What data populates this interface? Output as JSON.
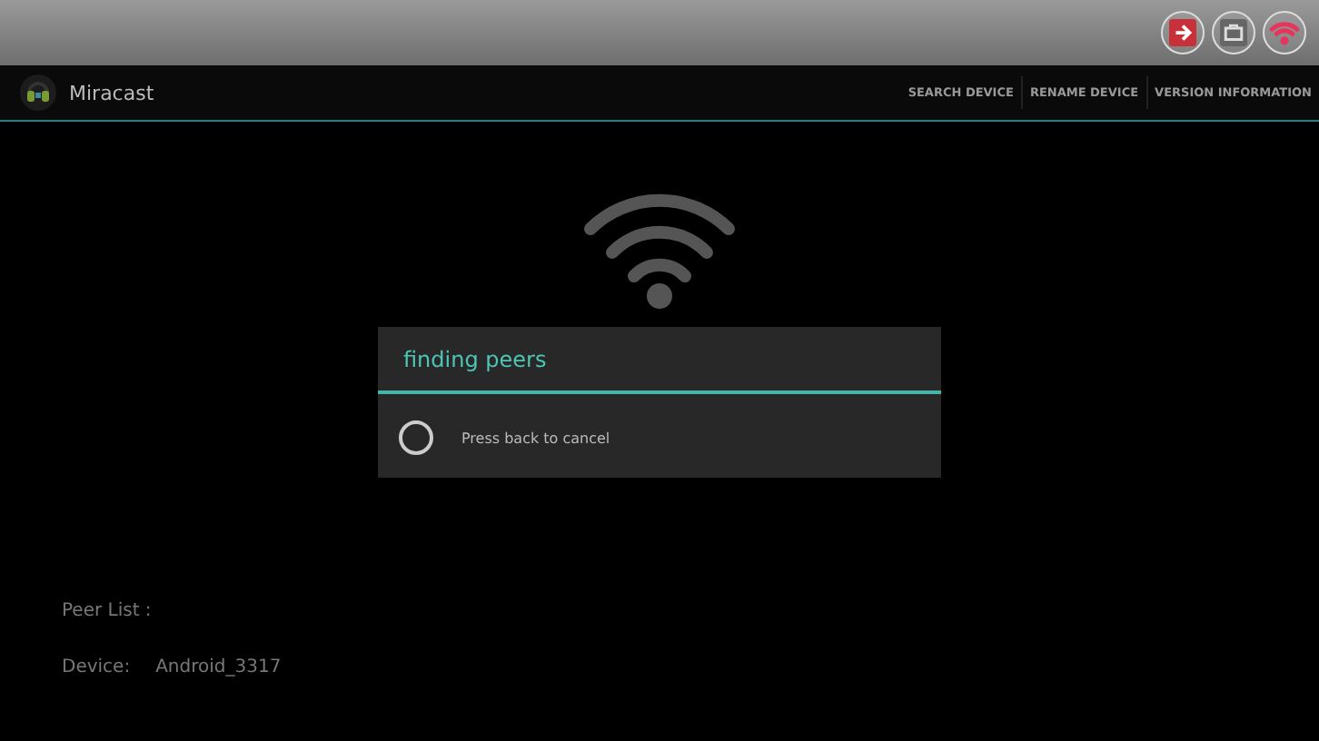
{
  "system_bar": {
    "buttons": [
      {
        "kind": "exit"
      },
      {
        "kind": "briefcase"
      },
      {
        "kind": "wifi"
      }
    ]
  },
  "action_bar": {
    "title": "Miracast",
    "actions": [
      "SEARCH DEVICE",
      "RENAME DEVICE",
      "VERSION INFORMATION"
    ]
  },
  "dialog": {
    "title": "finding peers",
    "message": "Press back to cancel"
  },
  "peer_list": {
    "label": "Peer List :"
  },
  "device": {
    "label": "Device:",
    "value": "Android_3317"
  }
}
